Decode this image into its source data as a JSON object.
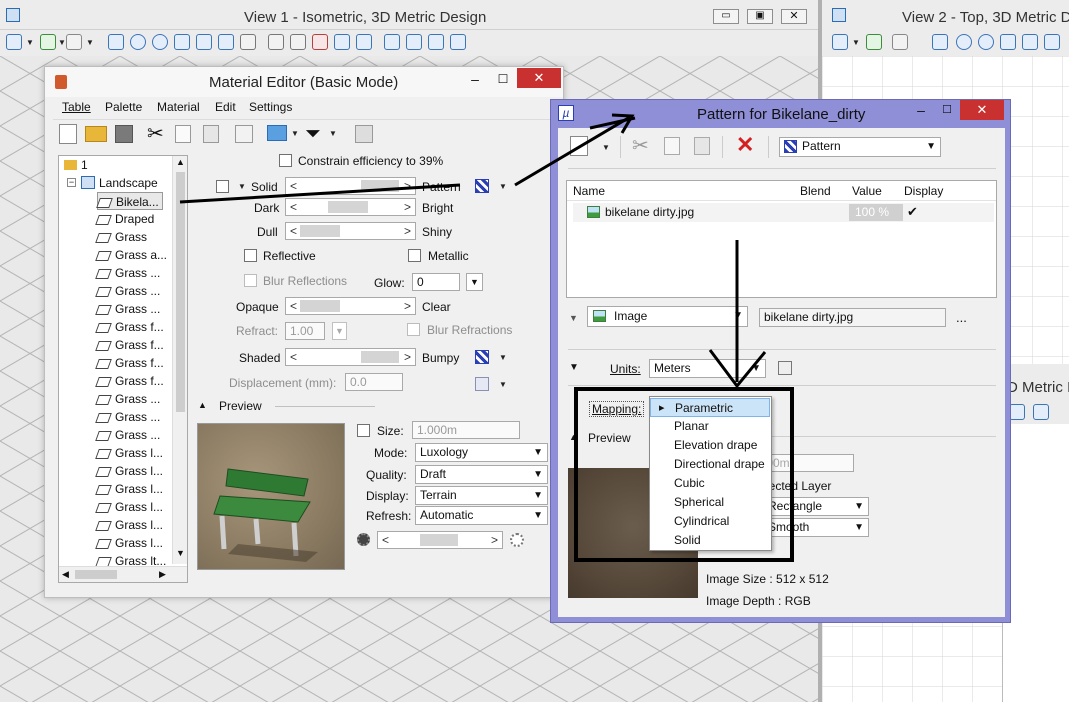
{
  "view1": {
    "title": "View 1 - Isometric, 3D Metric Design"
  },
  "view2": {
    "title": "View 2 - Top, 3D Metric D",
    "title_partial": "D Metric I"
  },
  "material_editor": {
    "title": "Material Editor (Basic Mode)",
    "menu": [
      "Table",
      "Palette",
      "Material",
      "Edit",
      "Settings"
    ],
    "constrain_label": "Constrain efficiency to 39%",
    "tree": {
      "root": "1",
      "group": "Landscape",
      "items": [
        "Bikela...",
        "Draped",
        "Grass",
        "Grass a...",
        "Grass ...",
        "Grass ...",
        "Grass ...",
        "Grass f...",
        "Grass f...",
        "Grass f...",
        "Grass f...",
        "Grass ...",
        "Grass ...",
        "Grass ...",
        "Grass l...",
        "Grass l...",
        "Grass l...",
        "Grass l...",
        "Grass l...",
        "Grass l...",
        "Grass lt..."
      ]
    },
    "props": {
      "solid": "Solid",
      "pattern": "Pattern",
      "dark": "Dark",
      "bright": "Bright",
      "dull": "Dull",
      "shiny": "Shiny",
      "reflective": "Reflective",
      "metallic": "Metallic",
      "blur_reflections": "Blur Reflections",
      "glow_label": "Glow:",
      "glow_value": "0",
      "opaque": "Opaque",
      "clear": "Clear",
      "refract_label": "Refract:",
      "refract_value": "1.00",
      "blur_refractions": "Blur Refractions",
      "shaded": "Shaded",
      "bumpy": "Bumpy",
      "displacement_label": "Displacement (mm):",
      "displacement_value": "0.0"
    },
    "preview": {
      "header": "Preview",
      "size_label": "Size:",
      "size_value": "1.000m",
      "mode_label": "Mode:",
      "mode_value": "Luxology",
      "quality_label": "Quality:",
      "quality_value": "Draft",
      "display_label": "Display:",
      "display_value": "Terrain",
      "refresh_label": "Refresh:",
      "refresh_value": "Automatic"
    }
  },
  "pattern_dialog": {
    "title": "Pattern for Bikelane_dirty",
    "pattern_dropdown": "Pattern",
    "columns": [
      "Name",
      "Blend",
      "Value",
      "Display"
    ],
    "row": {
      "name": "bikelane dirty.jpg",
      "value": "100 %",
      "display": "✔"
    },
    "image_type": "Image",
    "image_file": "bikelane dirty.jpg",
    "ellipsis": "...",
    "units_label": "Units:",
    "units_value": "Meters",
    "mapping_label": "Mapping:",
    "mapping_options": [
      "Parametric",
      "Planar",
      "Elevation drape",
      "Directional drape",
      "Cubic",
      "Spherical",
      "Cylindrical",
      "Solid"
    ],
    "preview_label": "Preview",
    "partial_field": ".00m",
    "partial_layer": "lected Layer",
    "partial_rect": "Rectangle",
    "partial_smooth": "Smooth",
    "image_size": "Image Size : 512 x 512",
    "image_depth": "Image Depth : RGB"
  },
  "colors": {
    "accent_border": "#8f8fd7",
    "close_red": "#c8312f",
    "selection": "#cce4f7"
  }
}
